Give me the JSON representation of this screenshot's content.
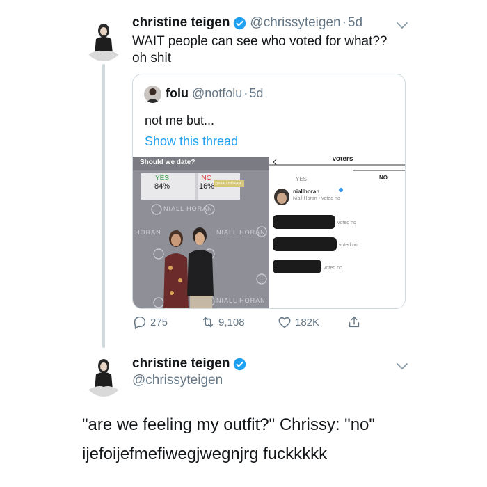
{
  "tweet1": {
    "name": "christine teigen",
    "handle": "@chrissyteigen",
    "separator": "·",
    "time": "5d",
    "text_line1": "WAIT people can see who voted for what??",
    "text_line2": "oh shit"
  },
  "quoted": {
    "name": "folu",
    "handle": "@notfolu",
    "separator": "·",
    "time": "5d",
    "text": "not me but...",
    "link": "Show this thread",
    "poll": {
      "question": "Should we date?",
      "options": [
        {
          "label": "YES",
          "percent": "84%"
        },
        {
          "label": "NO",
          "percent": "16%"
        }
      ],
      "sticker": "@NIALLHORAN",
      "backdrop_text": "NIALL HORAN"
    },
    "voters_panel": {
      "title": "Voters",
      "tab_yes": "YES",
      "tab_no": "NO",
      "first_voter_name": "niallhoran",
      "first_voter_subtitle": "Niall Horan",
      "voted_label": "voted no"
    }
  },
  "actions": {
    "replies": "275",
    "retweets": "9,108",
    "likes": "182K"
  },
  "tweet2": {
    "name": "christine teigen",
    "handle": "@chrissyteigen",
    "text_line1": "\"are we feeling my outfit?\" Chrissy: \"no\"",
    "text_line2": "ijefoijefmefiwegjwegnjrg fuckkkkk"
  },
  "colors": {
    "link_blue": "#1da1f2",
    "verified_blue": "#1da1f2",
    "muted_gray": "#657786",
    "border_gray": "#cfd9de"
  },
  "icons": [
    "verified-badge-icon",
    "chevron-down-icon",
    "reply-icon",
    "retweet-icon",
    "like-icon",
    "share-icon",
    "back-arrow-icon",
    "verified-small-icon"
  ]
}
